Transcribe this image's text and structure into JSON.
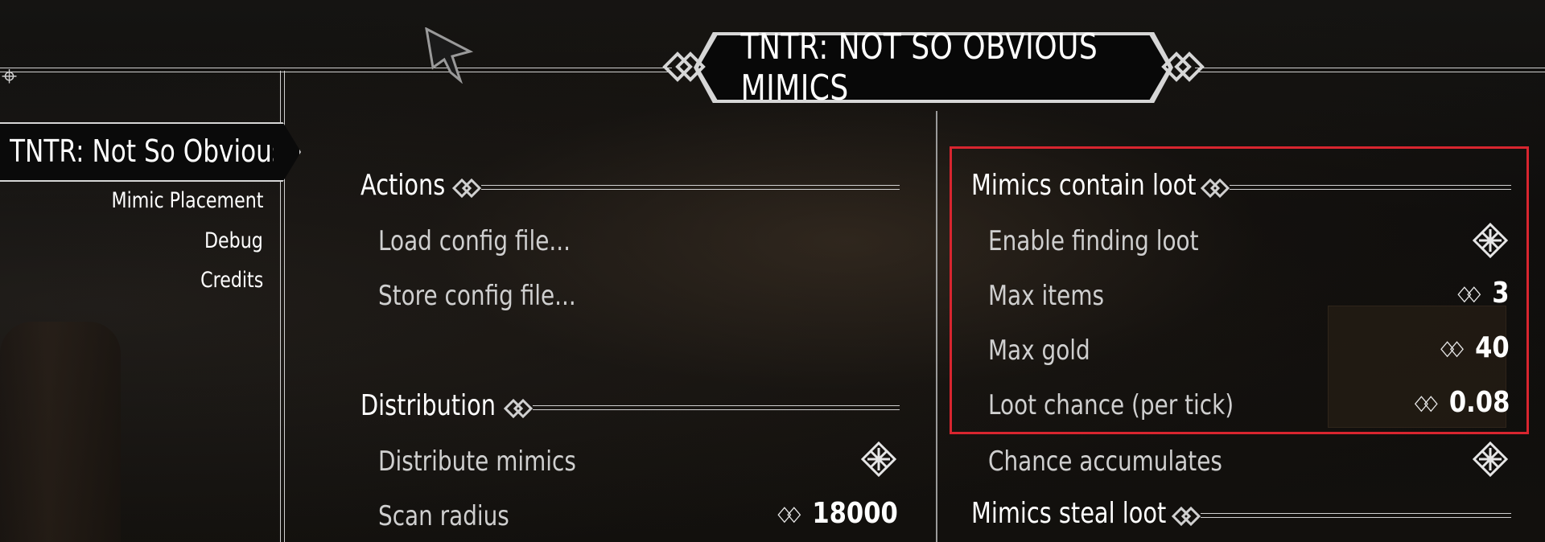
{
  "title": "TNTR: NOT SO OBVIOUS MIMICS",
  "nav": {
    "active": "TNTR: Not So Obvious Mimics",
    "items": [
      "Mimic Placement",
      "Debug",
      "Credits"
    ]
  },
  "left_column": {
    "sections": [
      {
        "title": "Actions",
        "options": [
          {
            "label": "Load config file..."
          },
          {
            "label": "Store config file..."
          }
        ]
      },
      {
        "title": "Distribution",
        "options": [
          {
            "label": "Distribute mimics",
            "type": "toggle",
            "icon": "toggle-checked-icon"
          },
          {
            "label": "Scan radius",
            "type": "slider",
            "value": "18000"
          }
        ]
      }
    ]
  },
  "right_column": {
    "sections": [
      {
        "title": "Mimics contain loot",
        "options": [
          {
            "label": "Enable finding loot",
            "type": "toggle",
            "icon": "toggle-checked-icon"
          },
          {
            "label": "Max items",
            "type": "slider",
            "value": "3"
          },
          {
            "label": "Max gold",
            "type": "slider",
            "value": "40"
          },
          {
            "label": "Loot chance (per tick)",
            "type": "slider",
            "value": "0.08"
          },
          {
            "label": "Chance accumulates",
            "type": "toggle",
            "icon": "toggle-checked-icon"
          }
        ]
      },
      {
        "title": "Mimics steal loot",
        "options": []
      }
    ]
  },
  "slider_arrow_glyph": "◇◇",
  "colors": {
    "highlight": "#d8252f",
    "text": "#ffffff",
    "muted_text": "#cfcfcf",
    "frame": "#cfcfcf"
  }
}
